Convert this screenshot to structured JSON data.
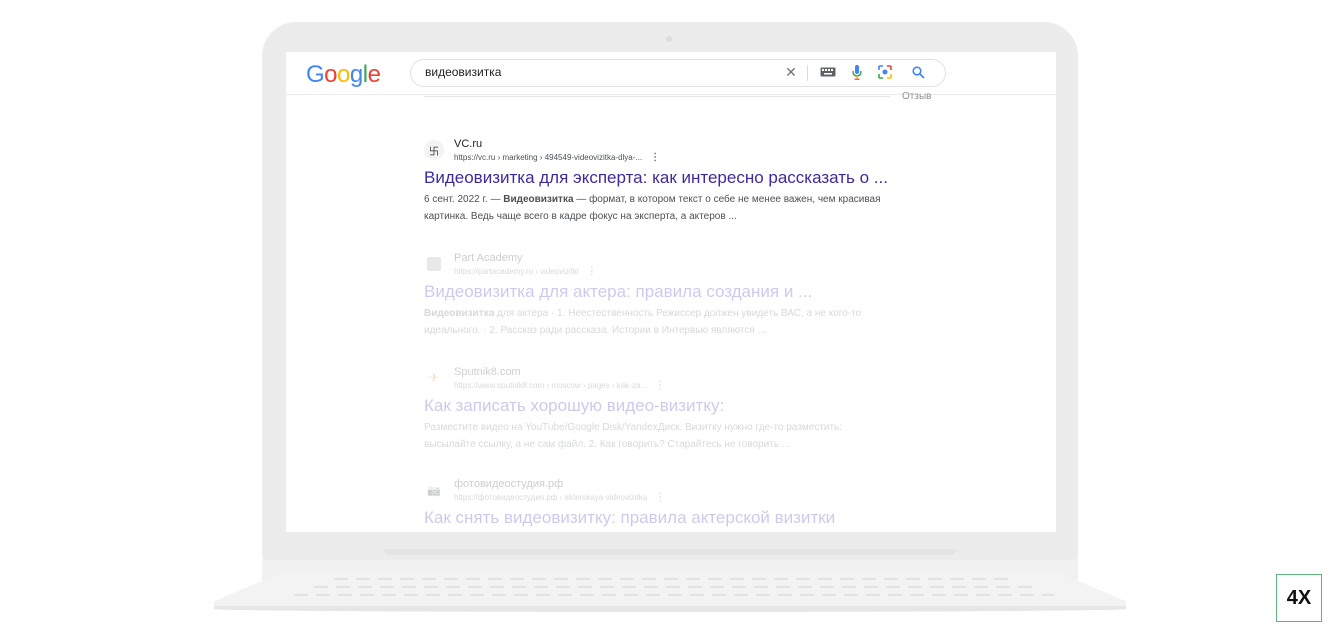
{
  "search": {
    "query": "видеовизитка"
  },
  "logo": {
    "letters": [
      "G",
      "o",
      "o",
      "g",
      "l",
      "e"
    ],
    "colors": [
      "#4285F4",
      "#EA4335",
      "#FBBC05",
      "#4285F4",
      "#34A853",
      "#EA4335"
    ]
  },
  "icons": {
    "clear": "close-icon",
    "keyboard": "keyboard-icon",
    "mic": "mic-icon",
    "lens": "lens-icon",
    "search": "search-icon"
  },
  "feedback_label": "Отзыв",
  "results": [
    {
      "favicon": "卐",
      "site": "VC.ru",
      "url": "https://vc.ru › marketing › 494549-videovizitka-dlya-...",
      "title": "Видеовизитка для эксперта: как интересно рассказать о ...",
      "snippet_date": "6 сент. 2022 г. — ",
      "snippet_bold": "Видеовизитка",
      "snippet_rest": " — формат, в котором текст о себе не менее важен, чем красивая картинка. Ведь чаще всего в кадре фокус на эксперта, а актеров ..."
    },
    {
      "favicon": "",
      "site": "Part Academy",
      "url": "https://partacademy.ru › videovizitki",
      "title": "Видеовизитка для актера: правила создания и ...",
      "snippet_bold": "Видеовизитка",
      "snippet_rest": " для актера · 1. Неестественность Режиссер должен увидеть ВАС, а не кого-то идеального. · 2. Рассказ ради рассказа. Истории в Интервью являются ..."
    },
    {
      "favicon": "✈",
      "site": "Sputnik8.com",
      "url": "https://www.sputnik8.com › moscow › pages › kak-za...",
      "title": "Как записать хорошую видео-визитку:",
      "snippet_rest": "Разместите видео на YouTube/Google Disk/YandexДиск. Визитку нужно где-то разместить: высылайте ссылку, а не сам файл. 2. Как говорить? Старайтесь не говорить ..."
    },
    {
      "favicon": "📷",
      "site": "фотовидеостудия.рф",
      "url": "https://фотовидеостудия.рф › akterskaya-videovizitka",
      "title": "Как снять видеовизитку: правила актерской визитки"
    }
  ],
  "badge": "4X"
}
